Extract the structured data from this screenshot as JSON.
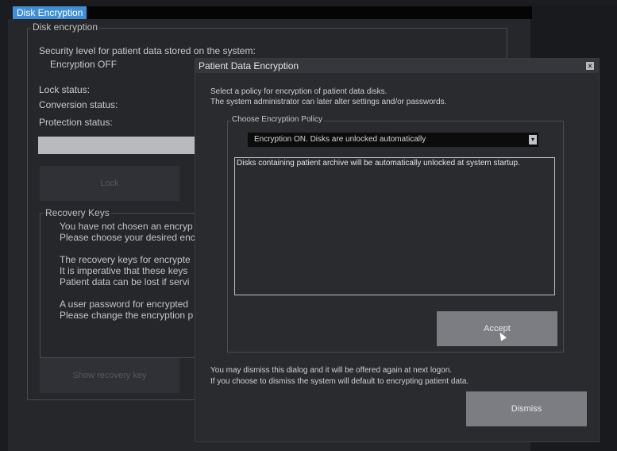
{
  "window": {
    "tab_title": "Disk Encryption"
  },
  "disk_encryption": {
    "group_title": "Disk encryption",
    "security_level_label": "Security level for patient data stored on the system:",
    "security_level_value": "Encryption OFF",
    "lock_status_label": "Lock status:",
    "conversion_status_label": "Conversion status:",
    "protection_status_label": "Protection status:",
    "lock_button": "Lock",
    "recovery_keys": {
      "title": "Recovery Keys",
      "lines": [
        "You have not chosen an encryp",
        "Please choose your desired enc",
        "",
        "The recovery keys for encrypte",
        "It is imperative that these keys",
        "Patient data can be lost if servi",
        "",
        "A user password for encrypted",
        "Please change the encryption p"
      ]
    },
    "show_recovery_key_button": "Show recovery key"
  },
  "dialog": {
    "title": "Patient Data Encryption",
    "close_glyph": "×",
    "intro_line1": "Select a policy for encryption of patient data disks.",
    "intro_line2": "The system administrator can later alter settings and/or passwords.",
    "policy_group_title": "Choose Encryption Policy",
    "selected_policy": "Encryption ON. Disks are unlocked automatically",
    "dropdown_arrow": "▾",
    "policy_description": "Disks containing patient archive will be automatically unlocked at system startup.",
    "accept_button": "Accept",
    "footer_line1": "You may dismiss this dialog and it will be offered again at next logon.",
    "footer_line2": "If you choose to dismiss the system will default to encrypting patient data.",
    "dismiss_button": "Dismiss"
  }
}
